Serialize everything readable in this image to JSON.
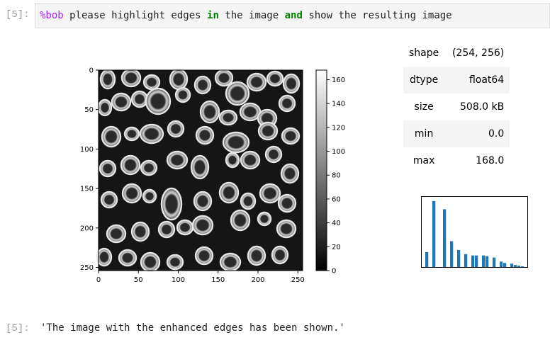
{
  "cells": {
    "input_prompt": "[5]:",
    "code": {
      "magic": "%bob",
      "t1": " please highlight edges ",
      "kw1": "in",
      "t2": " the image ",
      "kw2": "and",
      "t3": " show the resulting image"
    },
    "output_prompt": "[5]:",
    "output_text": "'The image with the enhanced edges has been shown.'"
  },
  "image_plot": {
    "y_ticks": [
      "0",
      "50",
      "100",
      "150",
      "200",
      "250"
    ],
    "x_ticks": [
      "0",
      "50",
      "100",
      "150",
      "200",
      "250"
    ],
    "colorbar_ticks": [
      "160",
      "140",
      "120",
      "100",
      "80",
      "60",
      "40",
      "20",
      "0"
    ],
    "colormap": "gray",
    "vmin": 0,
    "vmax": 168
  },
  "stats": [
    {
      "key": "shape",
      "value": "(254, 256)"
    },
    {
      "key": "dtype",
      "value": "float64"
    },
    {
      "key": "size",
      "value": "508.0 kB"
    },
    {
      "key": "min",
      "value": "0.0"
    },
    {
      "key": "max",
      "value": "168.0"
    }
  ],
  "chart_data": {
    "type": "bar",
    "title": "",
    "bar_color": "#1f77b4",
    "axes_visible": false,
    "values": [
      0.22,
      0.0,
      0.97,
      0.0,
      0.0,
      0.85,
      0.0,
      0.38,
      0.0,
      0.25,
      0.0,
      0.19,
      0.0,
      0.17,
      0.17,
      0.0,
      0.17,
      0.16,
      0.0,
      0.14,
      0.0,
      0.08,
      0.06,
      0.0,
      0.05,
      0.03,
      0.02,
      0.01
    ]
  }
}
